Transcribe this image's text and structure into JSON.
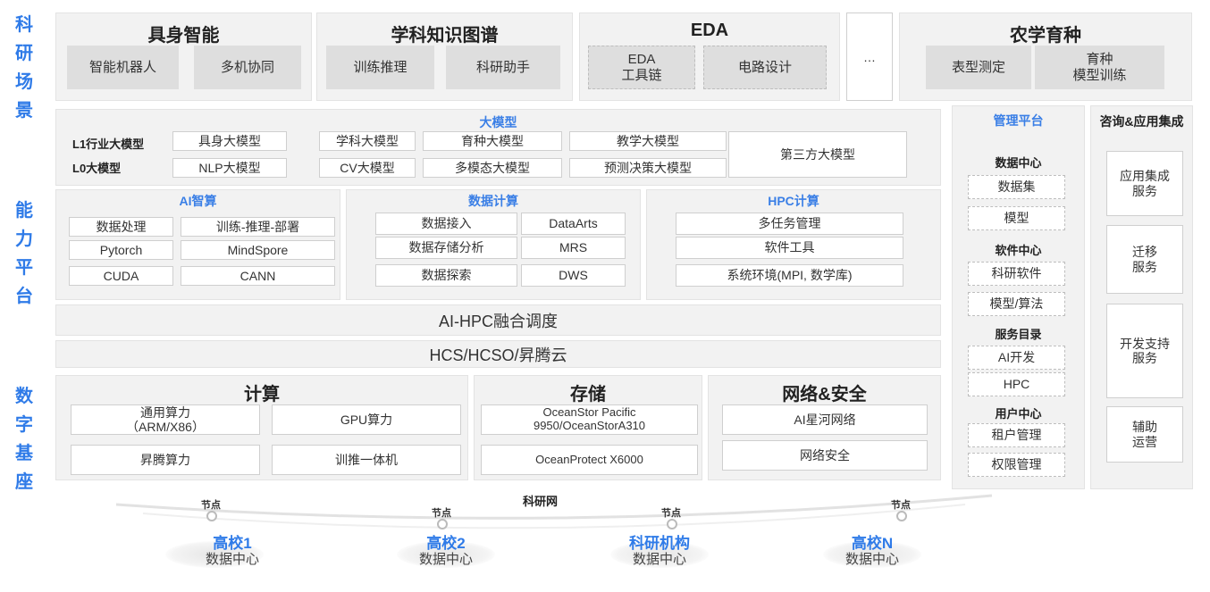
{
  "side_labels": {
    "scenarios": "科研场景",
    "capability": "能力平台",
    "digital_base": "数字基座"
  },
  "scenarios": {
    "embodied": {
      "title": "具身智能",
      "items": [
        "智能机器人",
        "多机协同"
      ]
    },
    "knowledge_graph": {
      "title": "学科知识图谱",
      "items": [
        "训练推理",
        "科研助手"
      ]
    },
    "eda": {
      "title": "EDA",
      "items": [
        "EDA\n工具链",
        "电路设计"
      ]
    },
    "ellipsis": "…",
    "agri": {
      "title": "农学育种",
      "items": [
        "表型测定",
        "育种\n模型训练"
      ]
    }
  },
  "large_model": {
    "title": "大模型",
    "l1_label": "L1行业大模型",
    "l0_label": "L0大模型",
    "l1_items": [
      "具身大模型",
      "学科大模型",
      "育种大模型",
      "教学大模型"
    ],
    "l0_items": [
      "NLP大模型",
      "CV大模型",
      "多模态大模型",
      "预测决策大模型"
    ],
    "third_party": "第三方大模型"
  },
  "ai_panel": {
    "title": "AI智算",
    "items": [
      "数据处理",
      "训练-推理-部署",
      "Pytorch",
      "MindSpore",
      "CUDA",
      "CANN"
    ]
  },
  "data_panel": {
    "title": "数据计算",
    "items": [
      "数据接入",
      "DataArts",
      "数据存储分析",
      "MRS",
      "数据探索",
      "DWS"
    ]
  },
  "hpc_panel": {
    "title": "HPC计算",
    "items": [
      "多任务管理",
      "软件工具",
      "系统环境(MPI, 数学库)"
    ]
  },
  "scheduling_bar": "AI-HPC融合调度",
  "cloud_bar": "HCS/HCSO/昇腾云",
  "compute": {
    "title": "计算",
    "items": [
      "通用算力\n（ARM/X86）",
      "GPU算力",
      "昇腾算力",
      "训推一体机"
    ]
  },
  "storage": {
    "title": "存储",
    "items": [
      "OceanStor Pacific\n9950/OceanStorA310",
      "OceanProtect X6000"
    ]
  },
  "network": {
    "title": "网络&安全",
    "items": [
      "AI星河网络",
      "网络安全"
    ]
  },
  "management": {
    "title": "管理平台",
    "sections": [
      {
        "head": "数据中心",
        "items": [
          "数据集",
          "模型"
        ]
      },
      {
        "head": "软件中心",
        "items": [
          "科研软件",
          "模型/算法"
        ]
      },
      {
        "head": "服务目录",
        "items": [
          "AI开发",
          "HPC"
        ]
      },
      {
        "head": "用户中心",
        "items": [
          "租户管理",
          "权限管理"
        ]
      }
    ]
  },
  "consulting": {
    "title": "咨询&应用集成",
    "items": [
      "应用集成\n服务",
      "迁移\n服务",
      "开发支持\n服务",
      "辅助\n运营"
    ]
  },
  "network_label": "科研网",
  "node_label": "节点",
  "sites": [
    {
      "name": "高校1",
      "sub": "数据中心"
    },
    {
      "name": "高校2",
      "sub": "数据中心"
    },
    {
      "name": "科研机构",
      "sub": "数据中心"
    },
    {
      "name": "高校N",
      "sub": "数据中心"
    }
  ],
  "colors": {
    "accent_blue": "#2f7be8",
    "panel_gray": "#f2f2f2",
    "cell_gray": "#dedede"
  }
}
